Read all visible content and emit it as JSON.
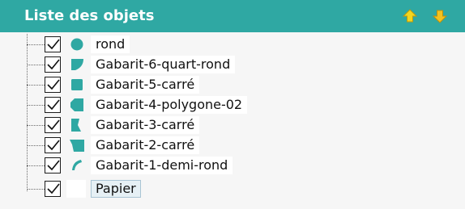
{
  "panel": {
    "title": "Liste des objets",
    "move_up_icon": "arrow-up-icon",
    "move_down_icon": "arrow-down-icon"
  },
  "colors": {
    "header_bg": "#2fa8a3",
    "shape_color": "#2fa8a3",
    "up_arrow": "#f2d61f",
    "down_arrow": "#f2c21f"
  },
  "items": [
    {
      "label": "rond",
      "checked": true,
      "shape_icon": "circle-icon"
    },
    {
      "label": "Gabarit-6-quart-rond",
      "checked": true,
      "shape_icon": "quarter-round-icon"
    },
    {
      "label": "Gabarit-5-carré",
      "checked": true,
      "shape_icon": "square-icon"
    },
    {
      "label": "Gabarit-4-polygone-02",
      "checked": true,
      "shape_icon": "polygon-icon"
    },
    {
      "label": "Gabarit-3-carré",
      "checked": true,
      "shape_icon": "notched-square-icon"
    },
    {
      "label": "Gabarit-2-carré",
      "checked": true,
      "shape_icon": "trapezoid-icon"
    },
    {
      "label": "Gabarit-1-demi-rond",
      "checked": true,
      "shape_icon": "half-round-icon"
    },
    {
      "label": "Papier",
      "checked": true,
      "shape_icon": "blank-icon",
      "selected": true
    }
  ]
}
